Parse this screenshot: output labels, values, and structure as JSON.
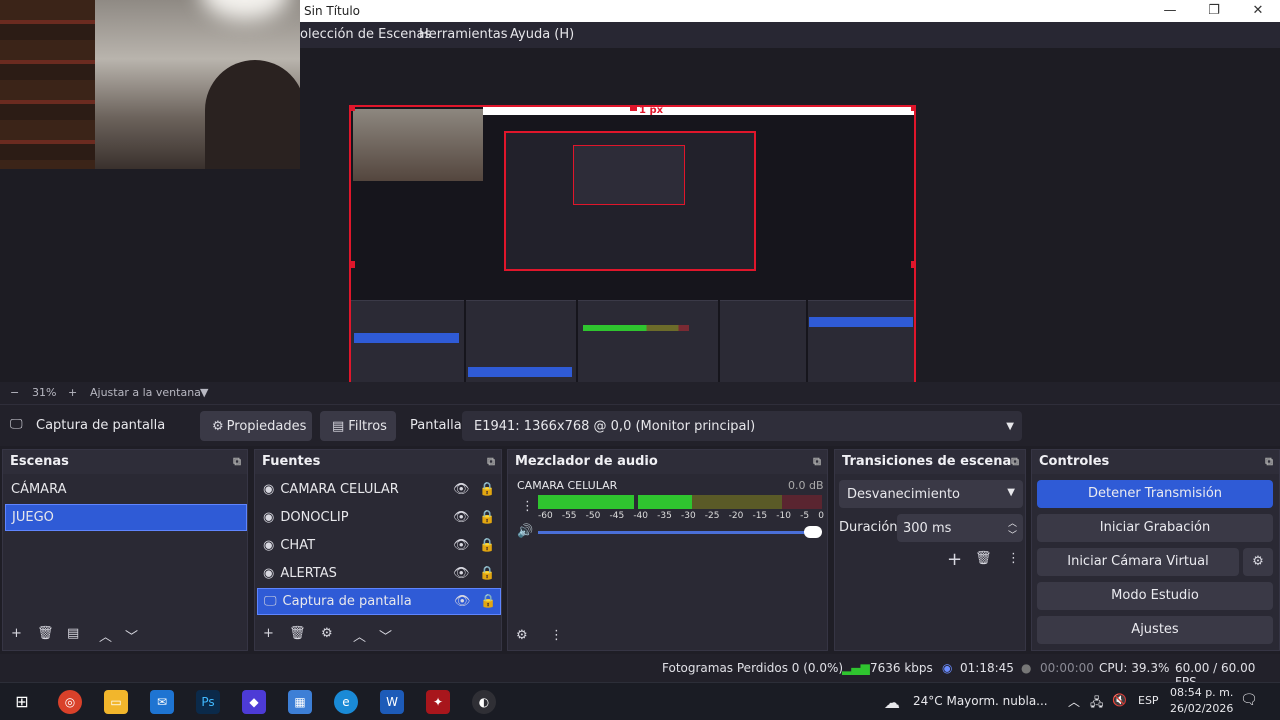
{
  "window": {
    "title": "Sin Título",
    "controls": {
      "minimize": "—",
      "maximize": "❐",
      "close": "✕"
    }
  },
  "menu": [
    "olección de Escenas",
    "Herramientas",
    "Ayuda (H)"
  ],
  "preview": {
    "size_label": "1 px",
    "zoom": "31%",
    "fit_label": "Ajustar a la ventana"
  },
  "sourcebar": {
    "source_name": "Captura de pantalla",
    "properties": "Propiedades",
    "filters": "Filtros",
    "screen_label": "Pantalla",
    "screen_value": "E1941: 1366x768 @ 0,0 (Monitor principal)"
  },
  "scenes": {
    "title": "Escenas",
    "items": [
      "CÁMARA",
      "JUEGO"
    ],
    "selected": "JUEGO"
  },
  "sources": {
    "title": "Fuentes",
    "items": [
      "CAMARA CELULAR",
      "DONOCLIP",
      "CHAT",
      "ALERTAS",
      "Captura de pantalla"
    ],
    "selected": "Captura de pantalla"
  },
  "mixer": {
    "title": "Mezclador de audio",
    "channel": "CAMARA CELULAR",
    "level": "0.0 dB",
    "ticks": [
      "-60",
      "-55",
      "-50",
      "-45",
      "-40",
      "-35",
      "-30",
      "-25",
      "-20",
      "-15",
      "-10",
      "-5",
      "0"
    ]
  },
  "transitions": {
    "title": "Transiciones de escena",
    "selected": "Desvanecimiento",
    "duration_label": "Duración",
    "duration_value": "300 ms"
  },
  "controls": {
    "title": "Controles",
    "stop_stream": "Detener Transmisión",
    "start_recording": "Iniciar Grabación",
    "start_virtual_cam": "Iniciar Cámara Virtual",
    "studio_mode": "Modo Estudio",
    "settings": "Ajustes"
  },
  "status": {
    "dropped_frames": "Fotogramas Perdidos 0 (0.0%)",
    "bitrate": "7636 kbps",
    "stream_time": "01:18:45",
    "rec_time": "00:00:00",
    "cpu": "CPU: 39.3%",
    "fps": "60.00 / 60.00 FPS"
  },
  "taskbar": {
    "weather": "24°C  Mayorm. nubla...",
    "lang": "ESP",
    "time": "08:54 p. m.",
    "date": "26/02/2026"
  },
  "colors": {
    "accent": "#2f5bd6",
    "selection_border": "#e0162b",
    "meter_green": "#2fc52f",
    "meter_yellow": "#c9c336",
    "meter_red": "#d23545"
  }
}
